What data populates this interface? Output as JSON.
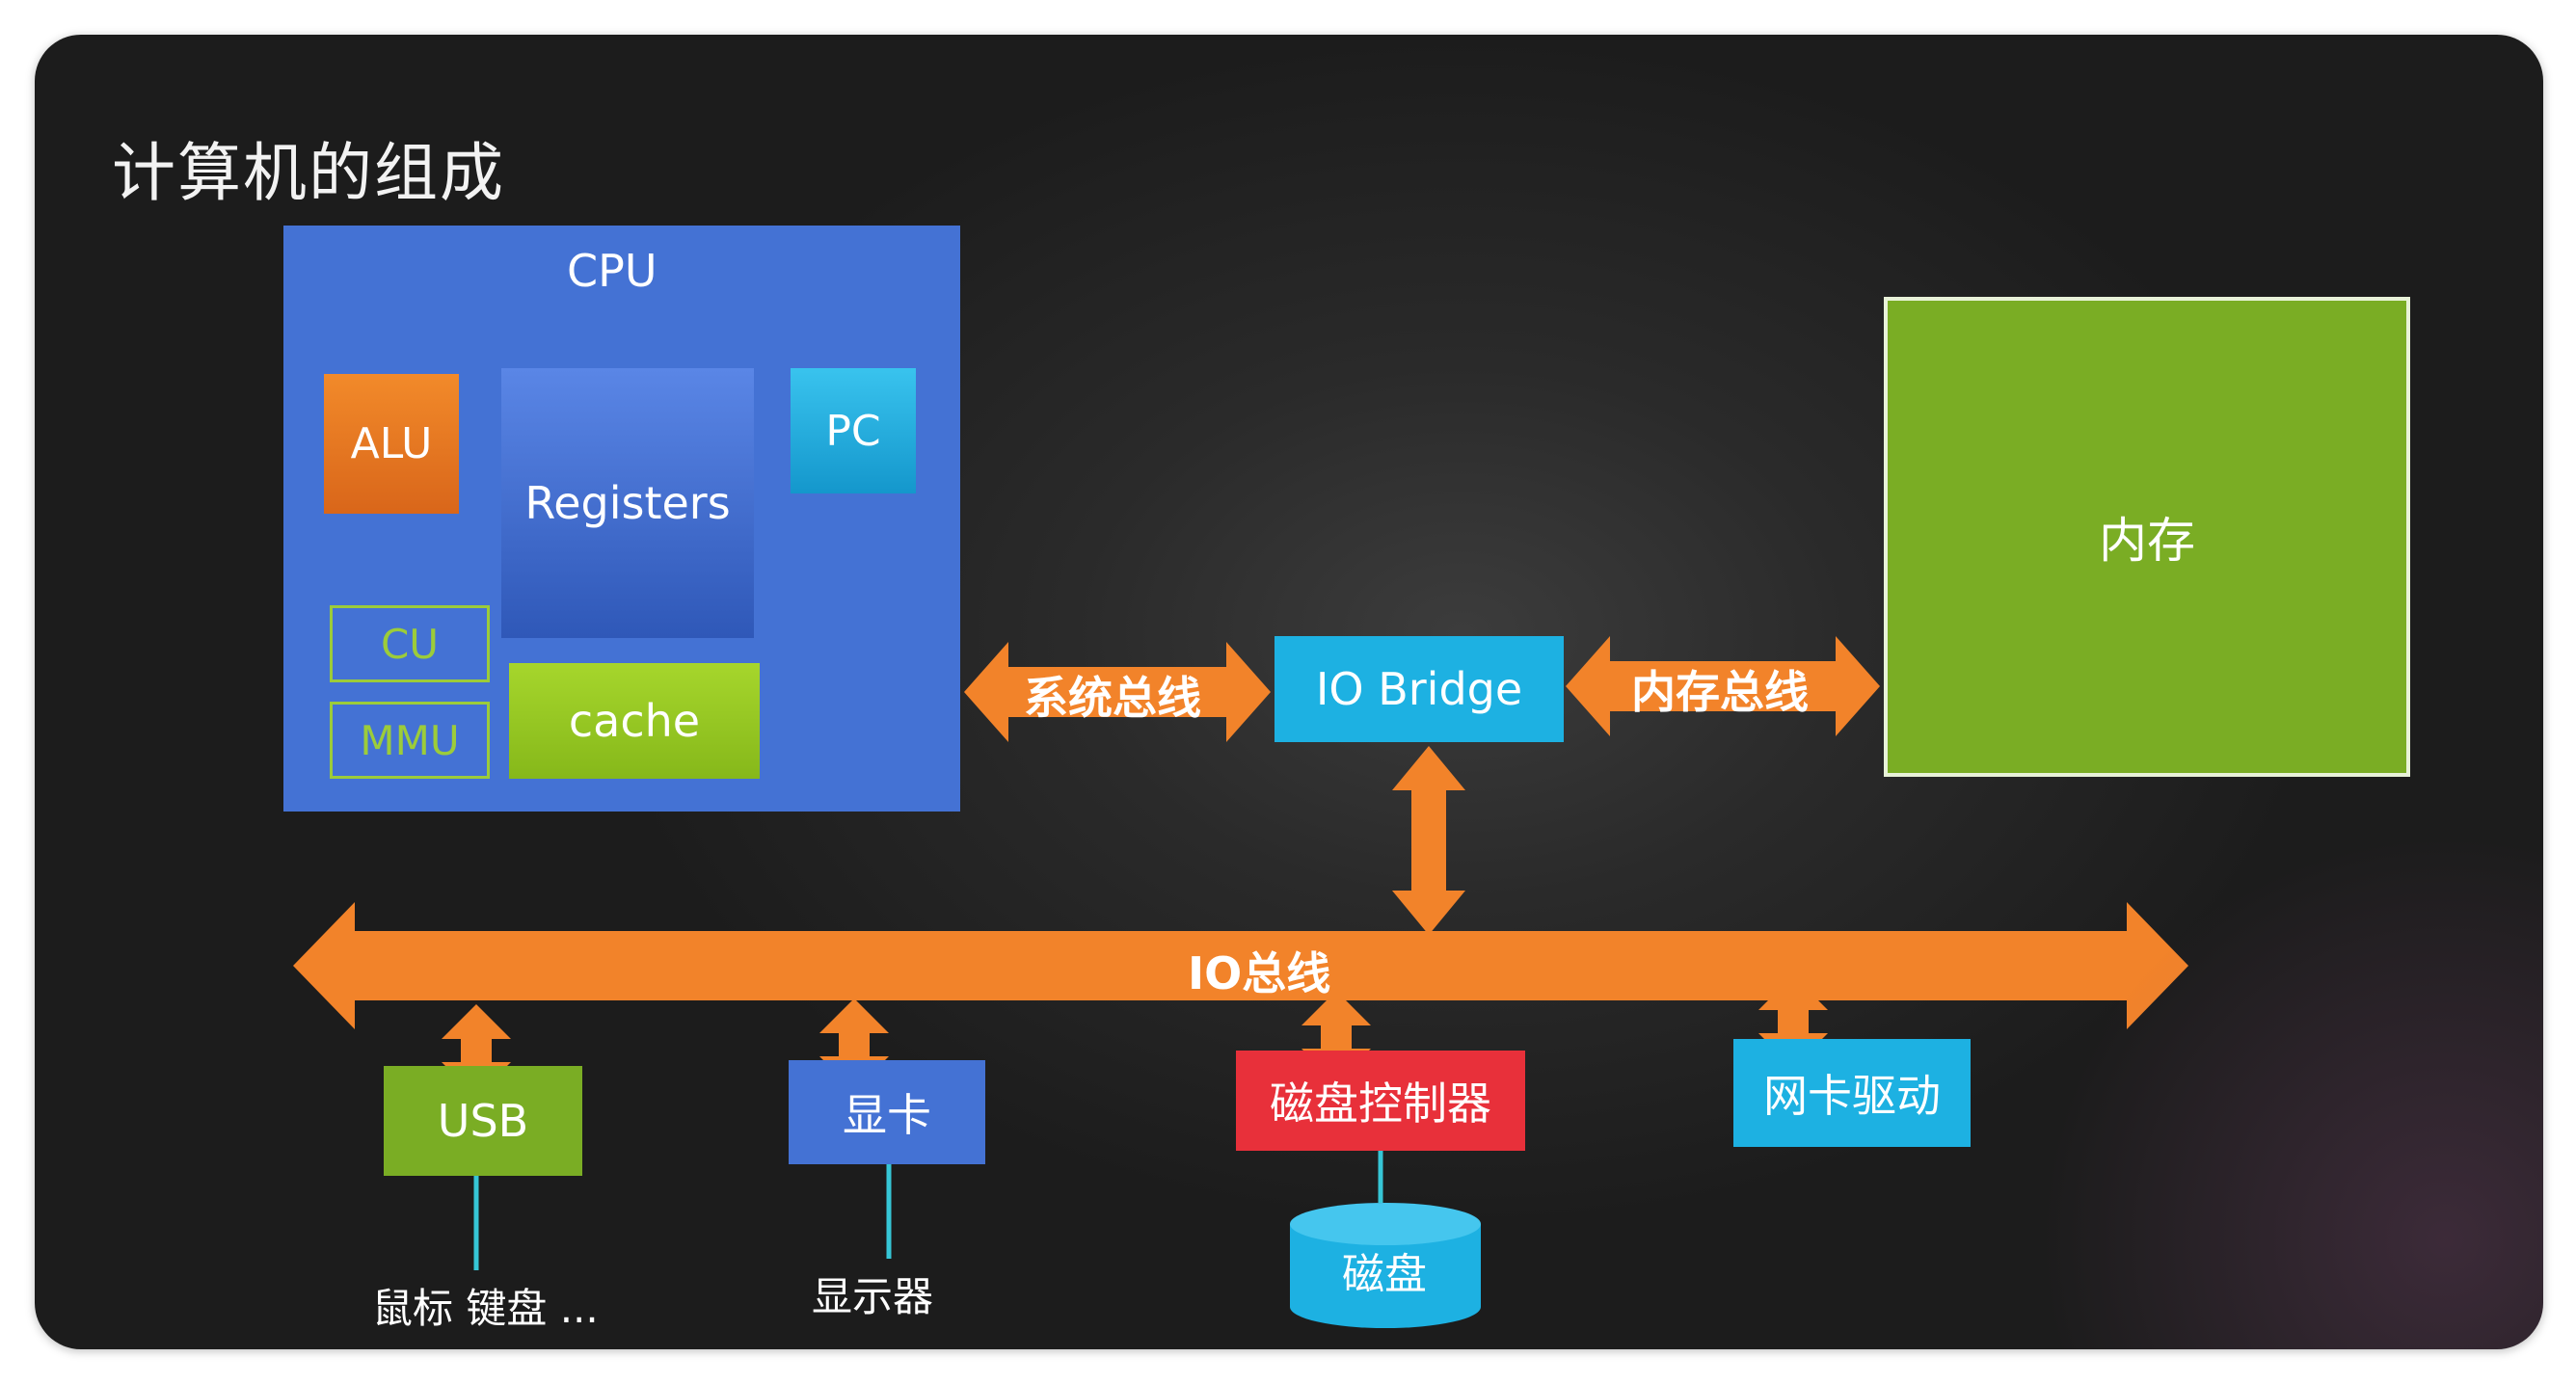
{
  "title": "计算机的组成",
  "cpu": {
    "label": "CPU",
    "alu": "ALU",
    "registers": "Registers",
    "pc": "PC",
    "cu": "CU",
    "mmu": "MMU",
    "cache": "cache"
  },
  "memory": {
    "label": "内存"
  },
  "bridge": {
    "label": "IO Bridge"
  },
  "buses": {
    "system": "系统总线",
    "memory": "内存总线",
    "io": "IO总线"
  },
  "devices": {
    "usb": "USB",
    "gpu": "显卡",
    "disk_controller": "磁盘控制器",
    "nic": "网卡驱动",
    "disk": "磁盘",
    "peripherals": "鼠标 键盘 ...",
    "display": "显示器"
  },
  "colors": {
    "cpu_blue": "#4472d4",
    "alu_orange": "#e8741a",
    "pc_cyan": "#1db1e2",
    "cache_green": "#8cc11c",
    "memory_green": "#7aad24",
    "arrow_orange": "#f2832a",
    "disk_red": "#e8303a"
  }
}
